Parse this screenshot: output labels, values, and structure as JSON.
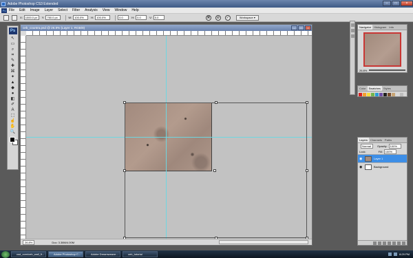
{
  "app": {
    "window_title": "Adobe Photoshop CS3 Extended",
    "logo_text": "Ps",
    "window_controls": [
      "–",
      "□",
      "×"
    ]
  },
  "menu": [
    "File",
    "Edit",
    "Image",
    "Layer",
    "Select",
    "Filter",
    "Analysis",
    "View",
    "Window",
    "Help"
  ],
  "options": {
    "x_label": "X:",
    "x_value": "1000.0 px",
    "y_label": "Y:",
    "y_value": "760.0 px",
    "w_label": "W:",
    "w_value": "100.0%",
    "h_label": "H:",
    "h_value": "100.0%",
    "angle_label": "0.0",
    "hskew_label": "H:",
    "hskew_value": "0.0",
    "vskew_label": "V:",
    "vskew_value": "0.0",
    "warp_label": "⌘",
    "cancel_label": "⊘",
    "commit_label": "✓",
    "workspace_label": "Workspace ▾"
  },
  "tools": [
    "↖",
    "▭",
    "⌕",
    "⌗",
    "✎",
    "✚",
    "⌘",
    "✦",
    "▲",
    "◆",
    "●",
    "◧",
    "✐",
    "A",
    "⬚",
    "☝",
    "✋",
    "🔍"
  ],
  "document": {
    "title": "ceb_countra.psd @ 26.8% (Layer 1, RGB/8)",
    "zoom": "26.8%",
    "doc_size": "Doc: 3.38M/4.00M"
  },
  "navigator_panel": {
    "tabs": [
      "Navigator",
      "Histogram",
      "Info"
    ],
    "zoom": "26.8%"
  },
  "color_panel": {
    "tabs": [
      "Color",
      "Swatches",
      "Styles"
    ],
    "swatch_colors": [
      "#d82020",
      "#f49e2e",
      "#f5dd3a",
      "#73b64d",
      "#2a9bd6",
      "#6f4ea6",
      "#202020",
      "#7a4d2e",
      "#c8a575",
      "#d9d9d9",
      "#bdbdbd"
    ]
  },
  "layers_panel": {
    "tabs": [
      "Layers",
      "Channels",
      "Paths"
    ],
    "blend_mode": "Normal",
    "opacity_label": "Opacity:",
    "opacity_value": "100%",
    "lock_label": "Lock:",
    "fill_label": "Fill:",
    "fill_value": "100%",
    "layers": [
      {
        "name": "Layer 1",
        "active": true,
        "thumb": "#a48d7f"
      },
      {
        "name": "Background",
        "active": false,
        "thumb": "#ffffff"
      }
    ]
  },
  "taskbar": {
    "items": [
      "csd_com/ceb_wall_fi...",
      "Adobe Photoshop C...",
      "Adobe Dreamweave...",
      "ceb_tutorial"
    ],
    "time": "8:29 PM"
  }
}
